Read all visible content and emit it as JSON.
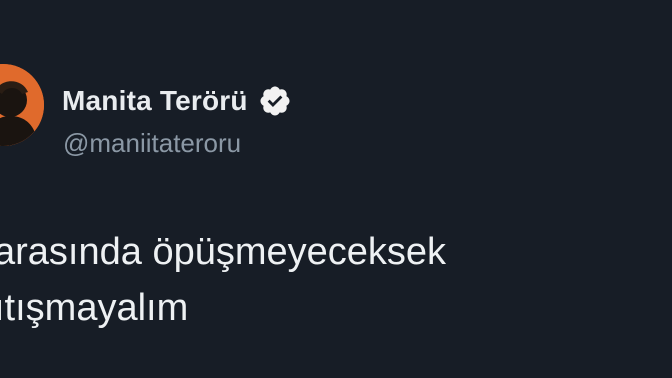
{
  "profile": {
    "display_name": "Manita Terörü",
    "handle": "@maniitateroru",
    "verified": true,
    "avatar_icon": "profile-avatar-silhouette",
    "avatar_color": "#e06a2c"
  },
  "tweet": {
    "lines": [
      "arasında öpüşmeyeceksek",
      "ıtışmayalım"
    ]
  },
  "colors": {
    "background": "#171d26",
    "name": "#e9ecef",
    "handle": "#8b98a5",
    "text": "#eef1f3"
  }
}
